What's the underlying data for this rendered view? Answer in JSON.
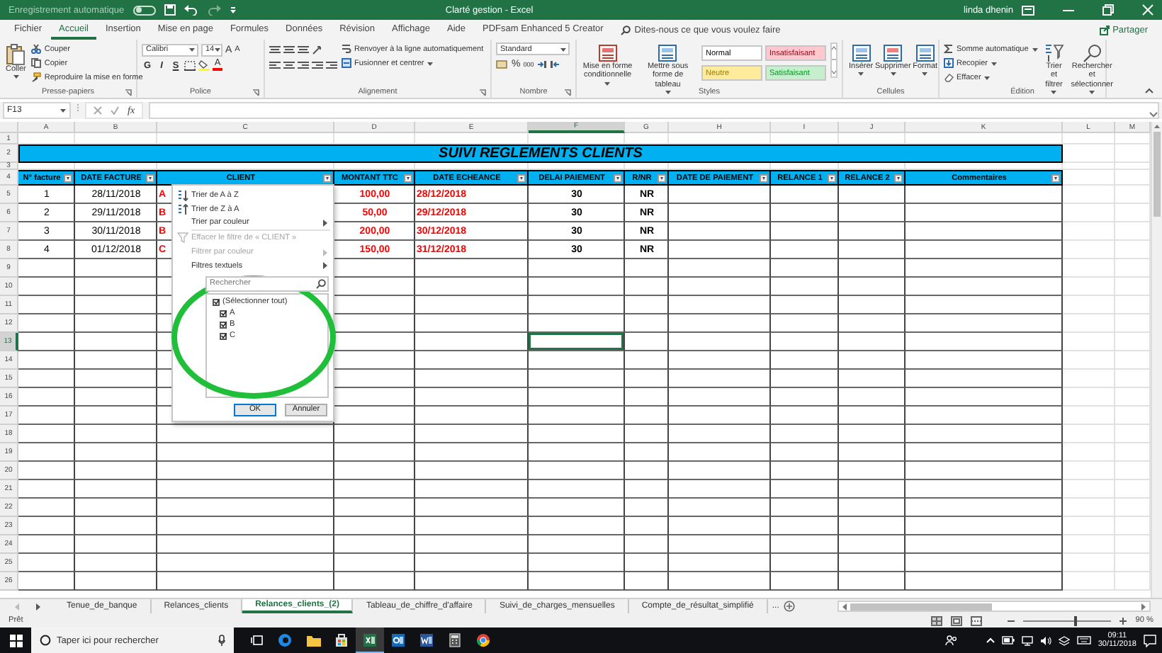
{
  "title_bar": {
    "autosave_label": "Enregistrement automatique",
    "autosave_on": false,
    "title": "Clarté gestion - Excel",
    "user": "linda dhenin"
  },
  "menu_tabs": [
    {
      "label": "Fichier",
      "selected": false
    },
    {
      "label": "Accueil",
      "selected": true
    },
    {
      "label": "Insertion",
      "selected": false
    },
    {
      "label": "Mise en page",
      "selected": false
    },
    {
      "label": "Formules",
      "selected": false
    },
    {
      "label": "Données",
      "selected": false
    },
    {
      "label": "Révision",
      "selected": false
    },
    {
      "label": "Affichage",
      "selected": false
    },
    {
      "label": "Aide",
      "selected": false
    },
    {
      "label": "PDFsam Enhanced 5 Creator",
      "selected": false
    }
  ],
  "tell_me": {
    "placeholder": "Dites-nous ce que vous voulez faire"
  },
  "share_button": "Partager",
  "ribbon": [
    {
      "kind": "clipboard",
      "label": "Presse-papiers",
      "large": "Coller",
      "small": [
        "Couper",
        "Copier",
        "Reproduire la mise en forme"
      ]
    },
    {
      "kind": "font",
      "label": "Police",
      "font": "Calibri",
      "size": "14",
      "grow": "A",
      "shrink": "A",
      "styles": [
        "G",
        "I",
        "S"
      ],
      "color_letter": "A"
    },
    {
      "kind": "alignment",
      "label": "Alignement",
      "small": [
        "Renvoyer à la ligne automatiquement",
        "Fusionner et centrer"
      ]
    },
    {
      "kind": "number",
      "label": "Nombre",
      "format": "Standard",
      "percent": "%",
      "thousands": "000"
    },
    {
      "kind": "styles",
      "label": "Styles",
      "large": [
        "Mise en forme conditionnelle",
        "Mettre sous forme de tableau"
      ],
      "cell_styles": [
        {
          "label": "Normal",
          "color": "#ffffff"
        },
        {
          "label": "Insatisfaisant",
          "color": "#ffc7ce"
        },
        {
          "label": "Neutre",
          "color": "#ffeb9c"
        },
        {
          "label": "Satisfaisant",
          "color": "#c6efce"
        }
      ]
    },
    {
      "kind": "cells",
      "label": "Cellules",
      "large": [
        "Insérer",
        "Supprimer",
        "Format"
      ]
    },
    {
      "kind": "editing",
      "label": "Édition",
      "small": [
        "Somme automatique",
        "Recopier",
        "Effacer"
      ],
      "large": [
        "Trier et filtrer",
        "Rechercher et sélectionner"
      ]
    }
  ],
  "formula_bar": {
    "name_box": "F13",
    "function_label": "fx"
  },
  "sheet": {
    "columns": [
      {
        "label": "A",
        "selected": false
      },
      {
        "label": "B",
        "selected": false
      },
      {
        "label": "C",
        "selected": false
      },
      {
        "label": "D",
        "selected": false
      },
      {
        "label": "E",
        "selected": false
      },
      {
        "label": "F",
        "selected": true
      },
      {
        "label": "G",
        "selected": false
      },
      {
        "label": "H",
        "selected": false
      },
      {
        "label": "I",
        "selected": false
      },
      {
        "label": "J",
        "selected": false
      },
      {
        "label": "K",
        "selected": false
      },
      {
        "label": "L",
        "selected": false
      },
      {
        "label": "M",
        "selected": false
      }
    ],
    "rows": [
      {
        "label": "1",
        "selected": false
      },
      {
        "label": "2",
        "selected": false
      },
      {
        "label": "3",
        "selected": false
      },
      {
        "label": "4",
        "selected": false
      },
      {
        "label": "5",
        "selected": false
      },
      {
        "label": "6",
        "selected": false
      },
      {
        "label": "7",
        "selected": false
      },
      {
        "label": "8",
        "selected": false
      },
      {
        "label": "9",
        "selected": false
      },
      {
        "label": "10",
        "selected": false
      },
      {
        "label": "11",
        "selected": false
      },
      {
        "label": "12",
        "selected": false
      },
      {
        "label": "13",
        "selected": true
      },
      {
        "label": "14",
        "selected": false
      },
      {
        "label": "15",
        "selected": false
      },
      {
        "label": "16",
        "selected": false
      },
      {
        "label": "17",
        "selected": false
      },
      {
        "label": "18",
        "selected": false
      },
      {
        "label": "19",
        "selected": false
      },
      {
        "label": "20",
        "selected": false
      },
      {
        "label": "21",
        "selected": false
      },
      {
        "label": "22",
        "selected": false
      },
      {
        "label": "23",
        "selected": false
      },
      {
        "label": "24",
        "selected": false
      },
      {
        "label": "25",
        "selected": false
      },
      {
        "label": "26",
        "selected": false
      }
    ],
    "title": "SUIVI REGLEMENTS CLIENTS",
    "headers": [
      "N° facture",
      "DATE FACTURE",
      "CLIENT",
      "MONTANT TTC",
      "DATE ECHEANCE",
      "DELAI PAIEMENT",
      "R/NR",
      "DATE DE PAIEMENT",
      "RELANCE 1",
      "RELANCE 2",
      "Commentaires"
    ],
    "records": [
      [
        "1",
        "28/11/2018",
        "A",
        "100,00",
        "28/12/2018",
        "30",
        "NR"
      ],
      [
        "2",
        "29/11/2018",
        "B",
        "50,00",
        "29/12/2018",
        "30",
        "NR"
      ],
      [
        "3",
        "30/11/2018",
        "B",
        "200,00",
        "30/12/2018",
        "30",
        "NR"
      ],
      [
        "4",
        "01/12/2018",
        "C",
        "150,00",
        "31/12/2018",
        "30",
        "NR"
      ]
    ]
  },
  "filter_menu": {
    "items": [
      {
        "kind": "sort_asc",
        "label": "Trier de A à Z",
        "disabled": false
      },
      {
        "kind": "sort_desc",
        "label": "Trier de Z à A",
        "disabled": false
      },
      {
        "kind": "submenu",
        "label": "Trier par couleur",
        "disabled": false
      },
      {
        "kind": "clear",
        "label": "Effacer le filtre de « CLIENT »",
        "disabled": true
      },
      {
        "kind": "submenu",
        "label": "Filtrer par couleur",
        "disabled": true
      },
      {
        "kind": "submenu",
        "label": "Filtres textuels",
        "disabled": false
      }
    ],
    "search": {
      "placeholder": "Rechercher"
    },
    "values": [
      {
        "label": "(Sélectionner tout)",
        "checked": true
      },
      {
        "label": "A",
        "checked": true
      },
      {
        "label": "B",
        "checked": true
      },
      {
        "label": "C",
        "checked": true
      }
    ],
    "buttons": [
      "OK",
      "Annuler"
    ]
  },
  "sheet_tabs": [
    {
      "label": "Tenue_de_banque",
      "selected": false
    },
    {
      "label": "Relances_clients",
      "selected": false
    },
    {
      "label": "Relances_clients_(2)",
      "selected": true
    },
    {
      "label": "Tableau_de_chiffre_d'affaire",
      "selected": false
    },
    {
      "label": "Suivi_de_charges_mensuelles",
      "selected": false
    },
    {
      "label": "Compte_de_résultat_simplifié",
      "selected": false
    }
  ],
  "more_tabs": "...",
  "status_bar": {
    "status": "Prêt",
    "zoom": "90 %",
    "zoom_slider": {
      "level": 0.6
    }
  },
  "taskbar": {
    "search_placeholder": "Taper ici pour rechercher",
    "time": "09:11",
    "date": "30/11/2018"
  }
}
